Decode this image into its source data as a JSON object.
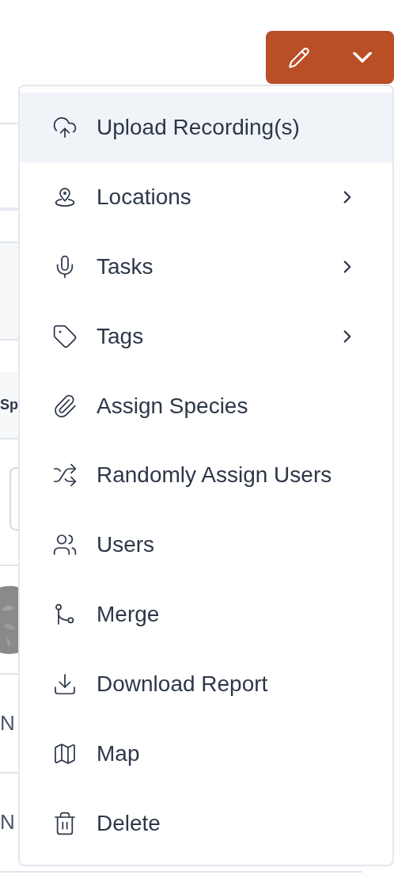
{
  "background": {
    "section_heading": "Sp",
    "rows": [
      "N",
      "N"
    ]
  },
  "action_button": {
    "expanded": true
  },
  "menu": {
    "items": [
      {
        "label": "Upload Recording(s)",
        "selected": true,
        "submenu": false
      },
      {
        "label": "Locations",
        "selected": false,
        "submenu": true
      },
      {
        "label": "Tasks",
        "selected": false,
        "submenu": true
      },
      {
        "label": "Tags",
        "selected": false,
        "submenu": true
      },
      {
        "label": "Assign Species",
        "selected": false,
        "submenu": false
      },
      {
        "label": "Randomly Assign Users",
        "selected": false,
        "submenu": false
      },
      {
        "label": "Users",
        "selected": false,
        "submenu": false
      },
      {
        "label": "Merge",
        "selected": false,
        "submenu": false
      },
      {
        "label": "Download Report",
        "selected": false,
        "submenu": false
      },
      {
        "label": "Map",
        "selected": false,
        "submenu": false
      },
      {
        "label": "Delete",
        "selected": false,
        "submenu": false
      }
    ]
  }
}
